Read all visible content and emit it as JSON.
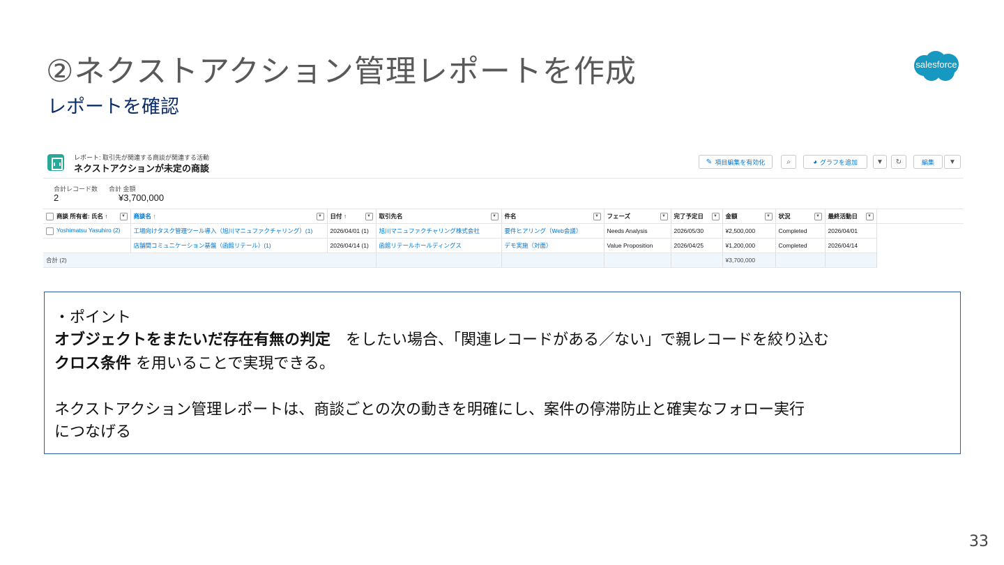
{
  "slide": {
    "title": "②ネクストアクション管理レポートを作成",
    "subtitle": "レポートを確認",
    "page_number": "33",
    "logo_text": "salesforce"
  },
  "report": {
    "breadcrumb": "レポート: 取引先が関連する商談が関連する活動",
    "name": "ネクストアクションが未定の商談",
    "buttons": {
      "enable_inline_edit": "項目編集を有効化",
      "add_chart": "グラフを追加",
      "edit": "編集"
    },
    "summary": {
      "record_count_label": "合計レコード数",
      "record_count": "2",
      "total_amount_label": "合計 金額",
      "total_amount": "¥3,700,000"
    },
    "columns": [
      "商談 所有者: 氏名 ↑",
      "商談名 ↑",
      "日付 ↑",
      "取引先名",
      "件名",
      "フェーズ",
      "完了予定日",
      "金額",
      "状況",
      "最終活動日"
    ],
    "rows": [
      {
        "owner": "Yoshimatsu Yasuhiro (2)",
        "opportunity": "工場向けタスク管理ツール導入（旭川マニュファクチャリング）(1)",
        "date": "2026/04/01 (1)",
        "account": "旭川マニュファクチャリング株式会社",
        "subject": "要件ヒアリング（Web会議）",
        "phase": "Needs Analysis",
        "close_date": "2026/05/30",
        "amount": "¥2,500,000",
        "status": "Completed",
        "last_activity": "2026/04/01"
      },
      {
        "owner": "",
        "opportunity": "店舗間コミュニケーション基盤（函館リテール）(1)",
        "date": "2026/04/14 (1)",
        "account": "函館リテールホールディングス",
        "subject": "デモ実施（対面）",
        "phase": "Value Proposition",
        "close_date": "2026/04/25",
        "amount": "¥1,200,000",
        "status": "Completed",
        "last_activity": "2026/04/14"
      }
    ],
    "total_label": "合計 (2)",
    "total_amount": "¥3,700,000"
  },
  "note": {
    "heading": "・ポイント",
    "bold1": "オブジェクトをまたいだ存在有無の判定",
    "text1": "　をしたい場合、「関連レコードがある／ない」で親レコードを絞り込む",
    "bold2": "クロス条件",
    "text2": " を用いることで実現できる。",
    "para2_line1": "ネクストアクション管理レポートは、商談ごとの次の動きを明確にし、案件の停滞防止と確実なフォロー実行",
    "para2_line2": "につなげる"
  }
}
